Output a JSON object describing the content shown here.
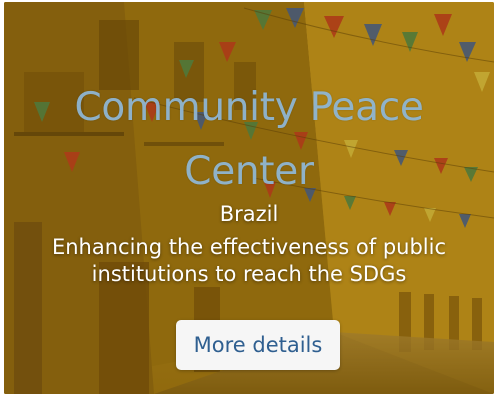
{
  "card": {
    "title": "Community Peace Center",
    "country": "Brazil",
    "description_line1": "Enhancing the effectiveness of public",
    "description_line2": "institutions to reach the SDGs",
    "button_label": "More details"
  },
  "colors": {
    "title": "#8fb6d3",
    "button_text": "#2f5f90",
    "overlay": "#b3890f"
  }
}
